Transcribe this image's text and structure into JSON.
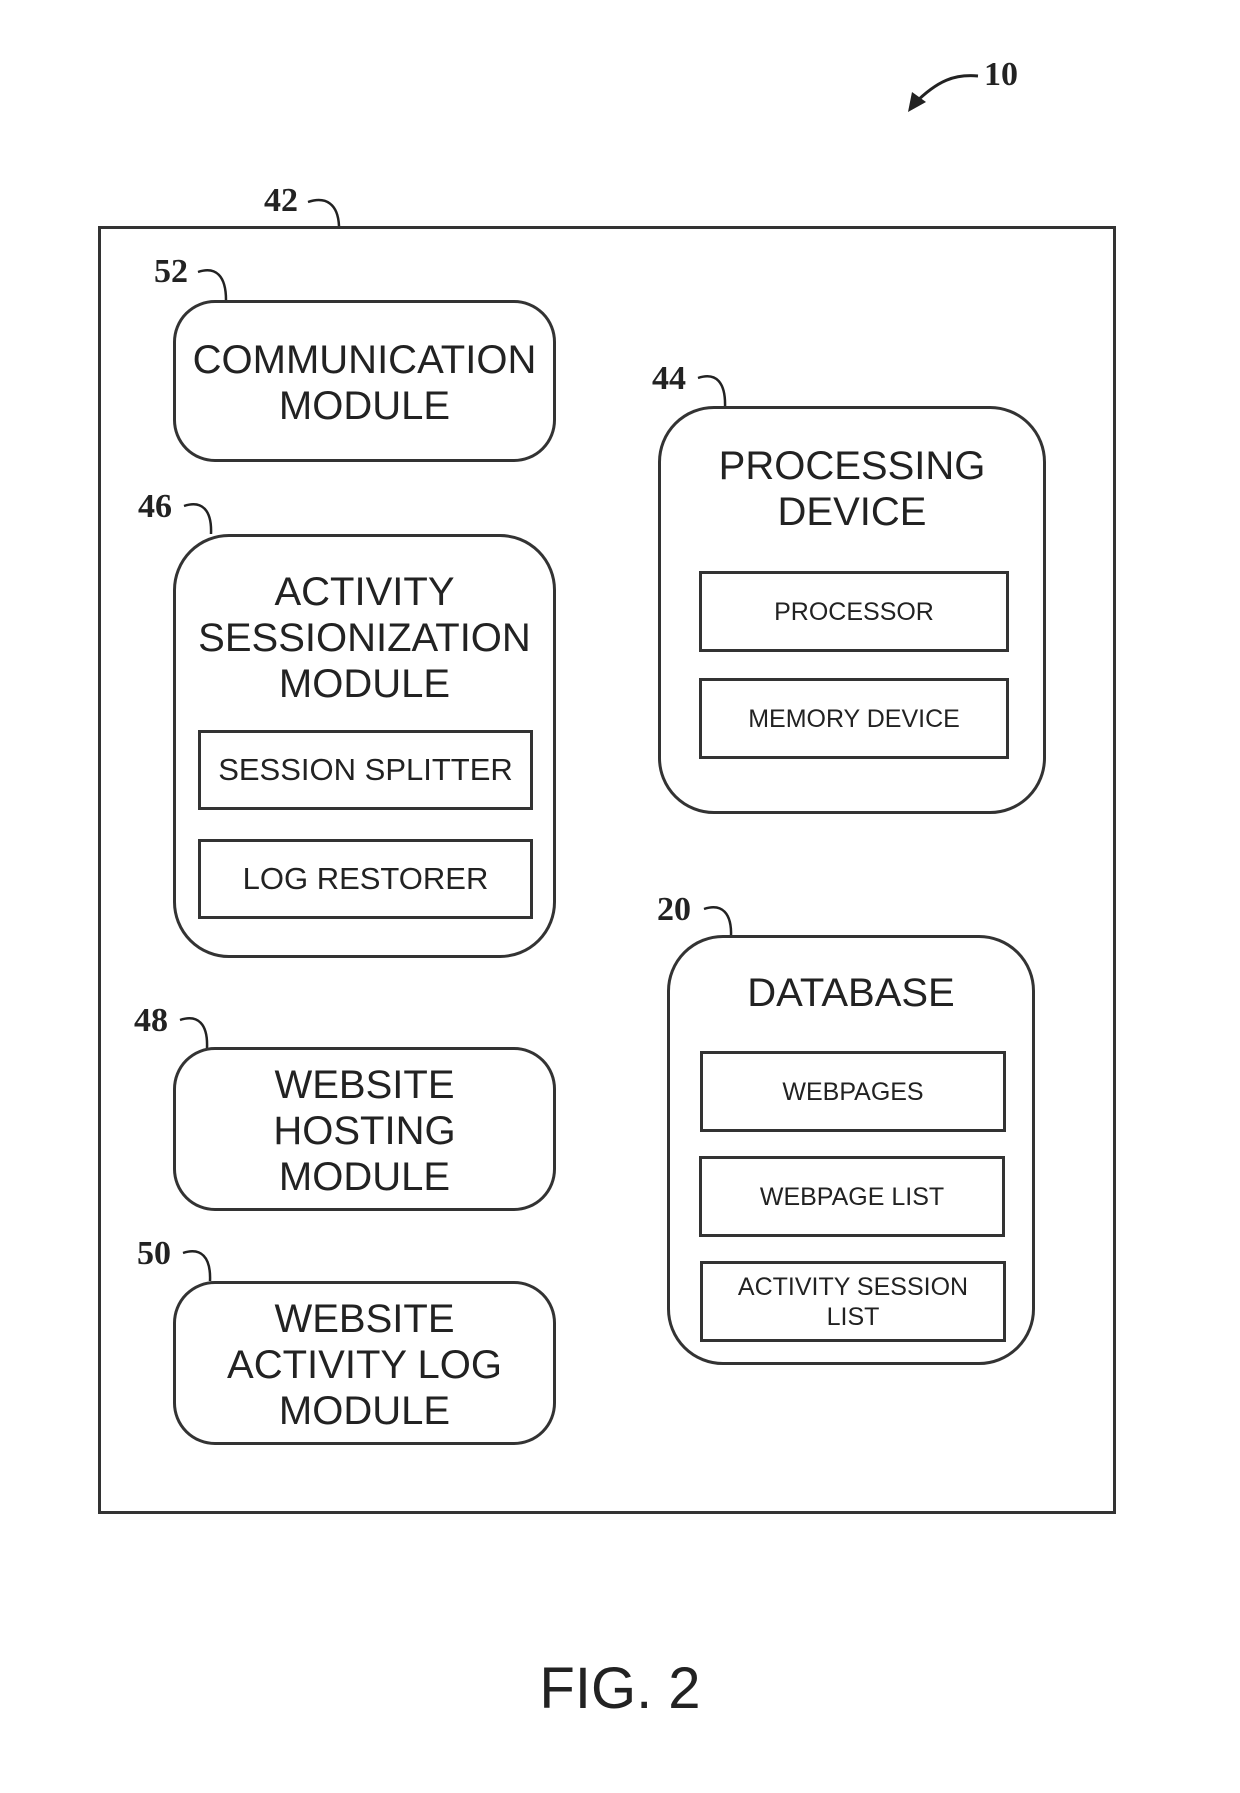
{
  "figure": {
    "label": "FIG. 2",
    "system_ref": "10",
    "container_ref": "42"
  },
  "components": {
    "communication": {
      "ref": "52",
      "title": "COMMUNICATION\nMODULE"
    },
    "sessionization": {
      "ref": "46",
      "title": "ACTIVITY\nSESSIONIZATION\nMODULE",
      "children": [
        "SESSION SPLITTER",
        "LOG RESTORER"
      ]
    },
    "hosting": {
      "ref": "48",
      "title": "WEBSITE\nHOSTING\nMODULE"
    },
    "activity_log": {
      "ref": "50",
      "title": "WEBSITE\nACTIVITY LOG\nMODULE"
    },
    "processing": {
      "ref": "44",
      "title": "PROCESSING\nDEVICE",
      "children": [
        "PROCESSOR",
        "MEMORY DEVICE"
      ]
    },
    "database": {
      "ref": "20",
      "title": "DATABASE",
      "children": [
        "WEBPAGES",
        "WEBPAGE LIST",
        "ACTIVITY SESSION\nLIST"
      ]
    }
  }
}
